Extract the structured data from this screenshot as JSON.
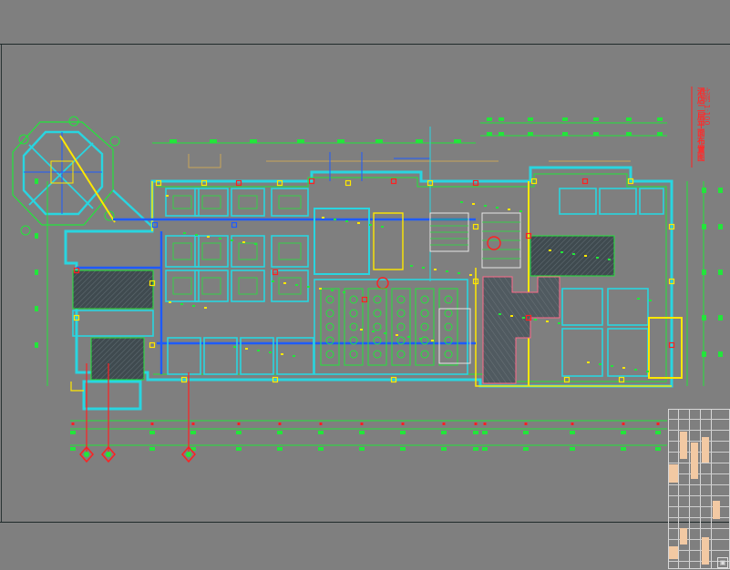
{
  "title_block": {
    "drawing_title": "酒店二层平面布置图",
    "scale_note": "比例 1:100"
  },
  "colors": {
    "background": "#7f7f7f",
    "wall_cyan": "#29d5e0",
    "line_green": "#22e63a",
    "line_yellow": "#ffe800",
    "line_red": "#ff2020",
    "line_blue": "#1e5bff",
    "line_white": "#e6e6e6",
    "hatch_dark": "#3f4a4f"
  },
  "icons": {
    "axis_marker": "red-circle-arrow-icon",
    "logo": "square-logo-icon"
  }
}
